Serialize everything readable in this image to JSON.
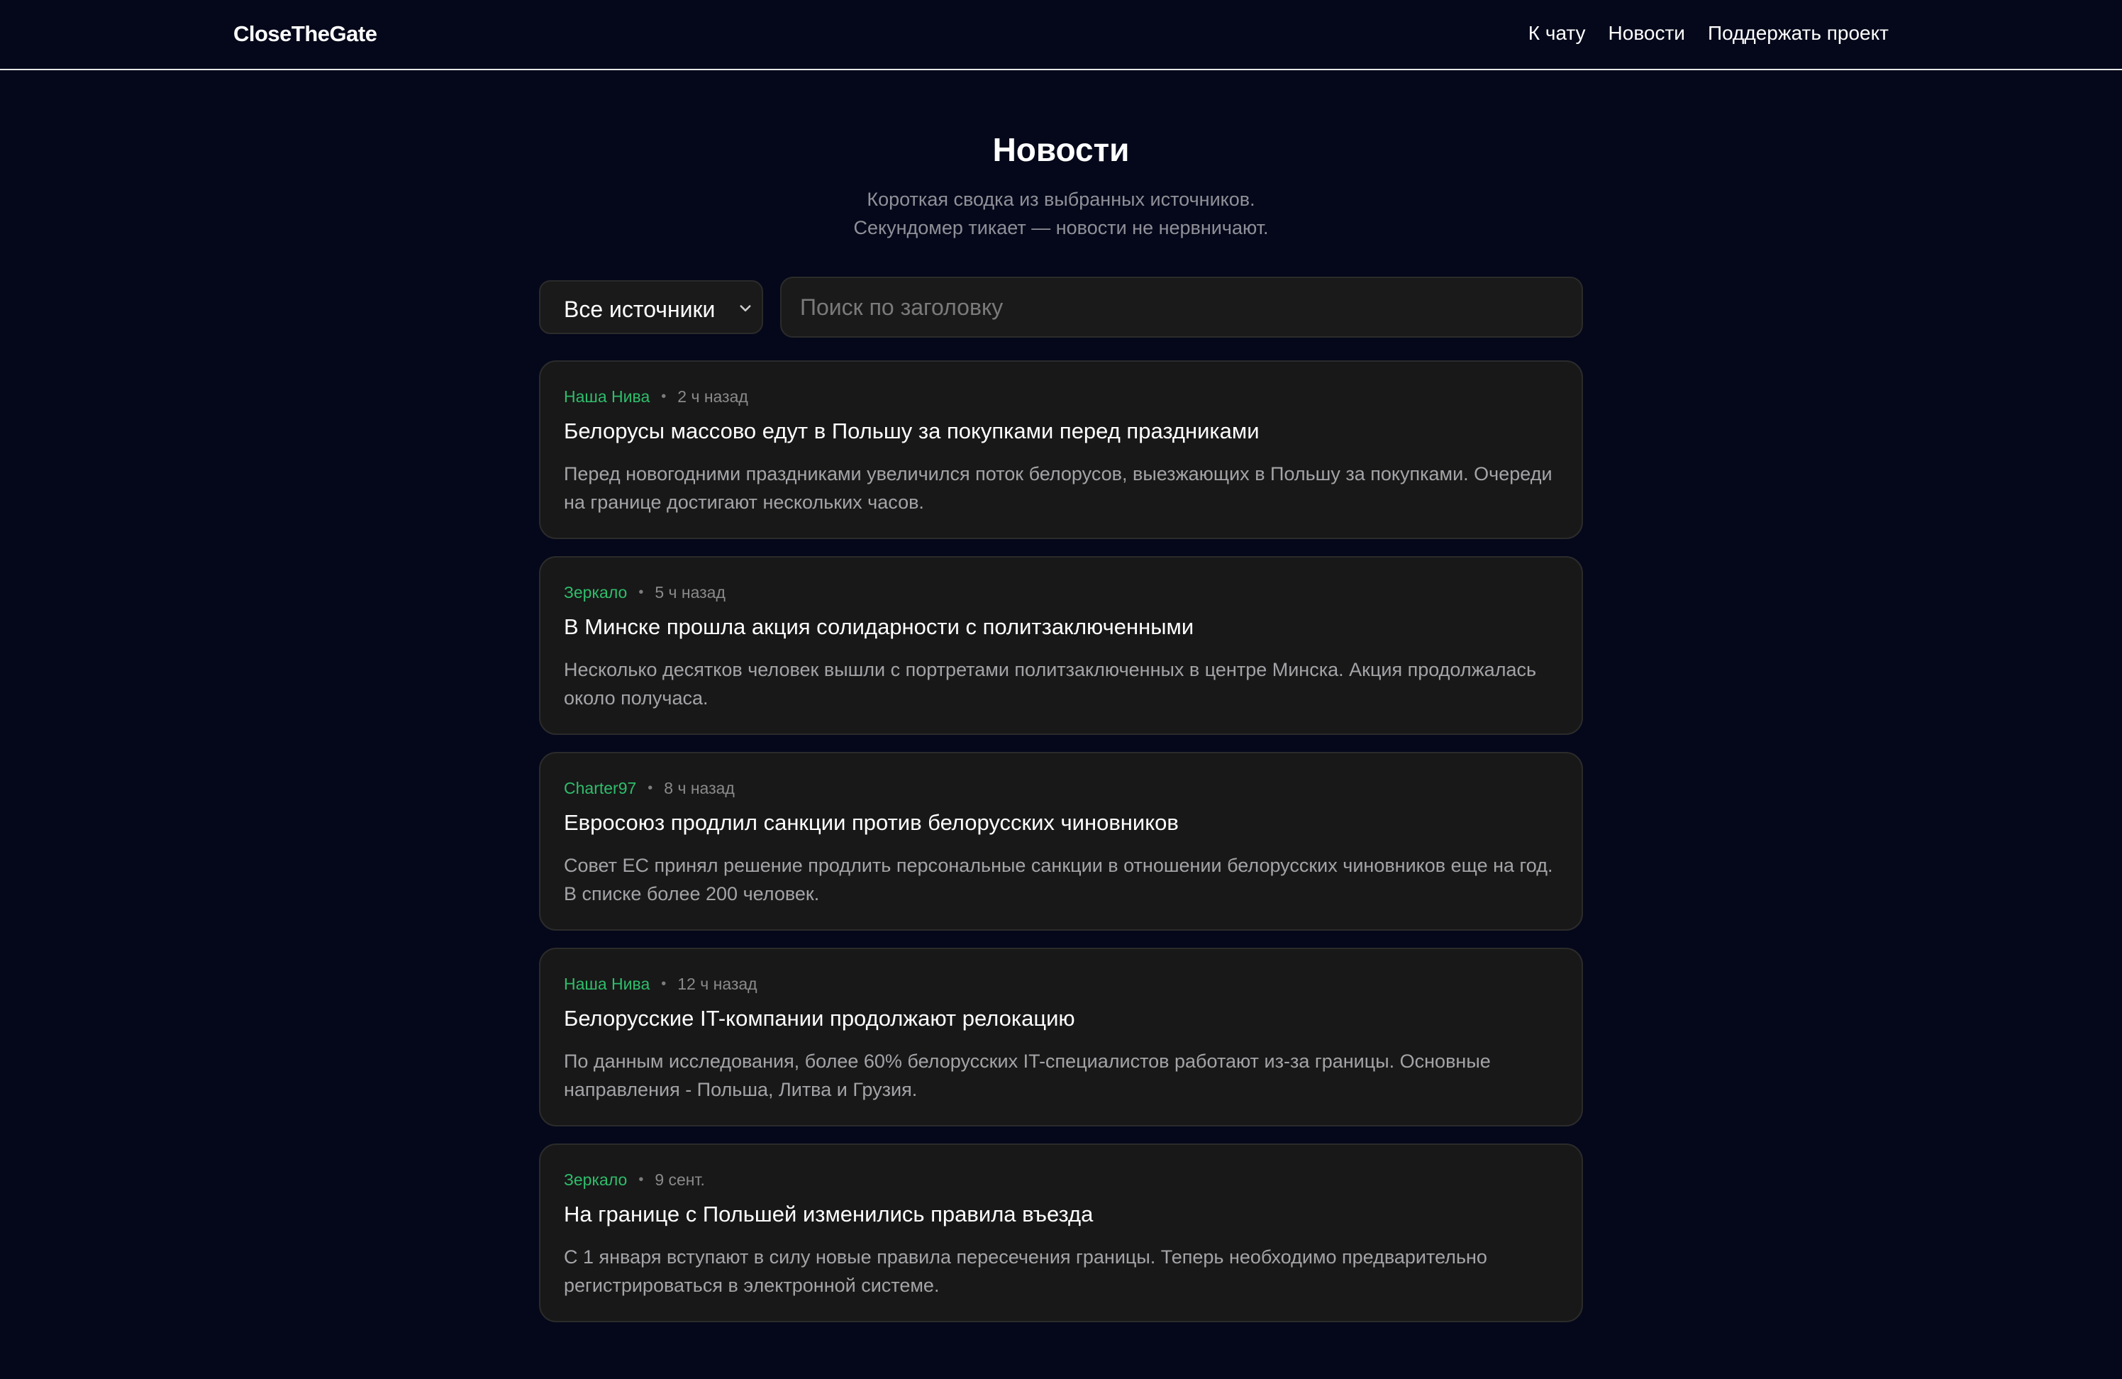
{
  "header": {
    "brand": "CloseTheGate",
    "nav": [
      {
        "label": "К чату"
      },
      {
        "label": "Новости"
      },
      {
        "label": "Поддержать проект"
      }
    ]
  },
  "hero": {
    "title": "Новости",
    "subtitle_line1": "Короткая сводка из выбранных источников.",
    "subtitle_line2": "Секундомер тикает — новости не нервничают."
  },
  "filters": {
    "source_select_value": "Все источники",
    "search_placeholder": "Поиск по заголовку",
    "search_value": ""
  },
  "news": [
    {
      "source": "Наша Нива",
      "time": "2 ч назад",
      "title": "Белорусы массово едут в Польшу за покупками перед праздниками",
      "description": "Перед новогодними праздниками увеличился поток белорусов, выезжающих в Польшу за покупками. Очереди на границе достигают нескольких часов."
    },
    {
      "source": "Зеркало",
      "time": "5 ч назад",
      "title": "В Минске прошла акция солидарности с политзаключенными",
      "description": "Несколько десятков человек вышли с портретами политзаключенных в центре Минска. Акция продолжалась около получаса."
    },
    {
      "source": "Charter97",
      "time": "8 ч назад",
      "title": "Евросоюз продлил санкции против белорусских чиновников",
      "description": "Совет ЕС принял решение продлить персональные санкции в отношении белорусских чиновников еще на год. В списке более 200 человек."
    },
    {
      "source": "Наша Нива",
      "time": "12 ч назад",
      "title": "Белорусские IT-компании продолжают релокацию",
      "description": "По данным исследования, более 60% белорусских IT-специалистов работают из-за границы. Основные направления - Польша, Литва и Грузия."
    },
    {
      "source": "Зеркало",
      "time": "9 сент.",
      "title": "На границе с Польшей изменились правила въезда",
      "description": "С 1 января вступают в силу новые правила пересечения границы. Теперь необходимо предварительно регистрироваться в электронной системе."
    }
  ],
  "colors": {
    "background": "#05081a",
    "card": "#181818",
    "source_accent": "#2fbd6b"
  }
}
